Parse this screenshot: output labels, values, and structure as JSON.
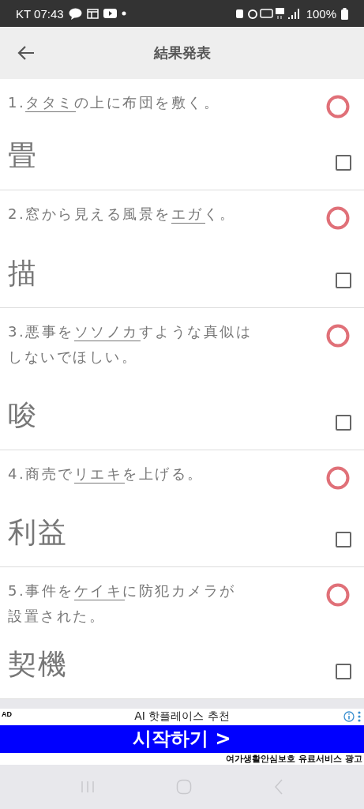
{
  "status_bar": {
    "carrier_time": "KT 07:43",
    "battery": "100%"
  },
  "header": {
    "title": "結果発表"
  },
  "items": [
    {
      "question": [
        [
          {
            "text": "1.",
            "underlined": false
          },
          {
            "text": "タタミ",
            "underlined": true
          },
          {
            "text": "の上に布団を敷く。",
            "underlined": false
          }
        ]
      ],
      "answer": "畳",
      "correct": true,
      "checked": false
    },
    {
      "question": [
        [
          {
            "text": "2.窓から見える風景を",
            "underlined": false
          },
          {
            "text": "エガ",
            "underlined": true
          },
          {
            "text": "く。",
            "underlined": false
          }
        ]
      ],
      "answer": "描",
      "correct": true,
      "checked": false
    },
    {
      "question": [
        [
          {
            "text": "3.悪事を",
            "underlined": false
          },
          {
            "text": "ソソノカ",
            "underlined": true
          },
          {
            "text": "すような真似は",
            "underlined": false
          }
        ],
        [
          {
            "text": "しないでほしい。",
            "underlined": false
          }
        ]
      ],
      "answer": "唆",
      "correct": true,
      "checked": false
    },
    {
      "question": [
        [
          {
            "text": "4.商売で",
            "underlined": false
          },
          {
            "text": "リエキ",
            "underlined": true
          },
          {
            "text": "を上げる。",
            "underlined": false
          }
        ]
      ],
      "answer": "利益",
      "correct": true,
      "checked": false
    },
    {
      "question": [
        [
          {
            "text": "5.事件を",
            "underlined": false
          },
          {
            "text": "ケイキ",
            "underlined": true
          },
          {
            "text": "に防犯カメラが",
            "underlined": false
          }
        ],
        [
          {
            "text": "設置された。",
            "underlined": false
          }
        ]
      ],
      "answer": "契機",
      "correct": true,
      "checked": false
    }
  ],
  "ad": {
    "label": "AD",
    "title": "AI 핫플레이스 추천",
    "button": "시작하기 >",
    "disclaimer": "여가생활안심보호 유료서비스 광고"
  }
}
